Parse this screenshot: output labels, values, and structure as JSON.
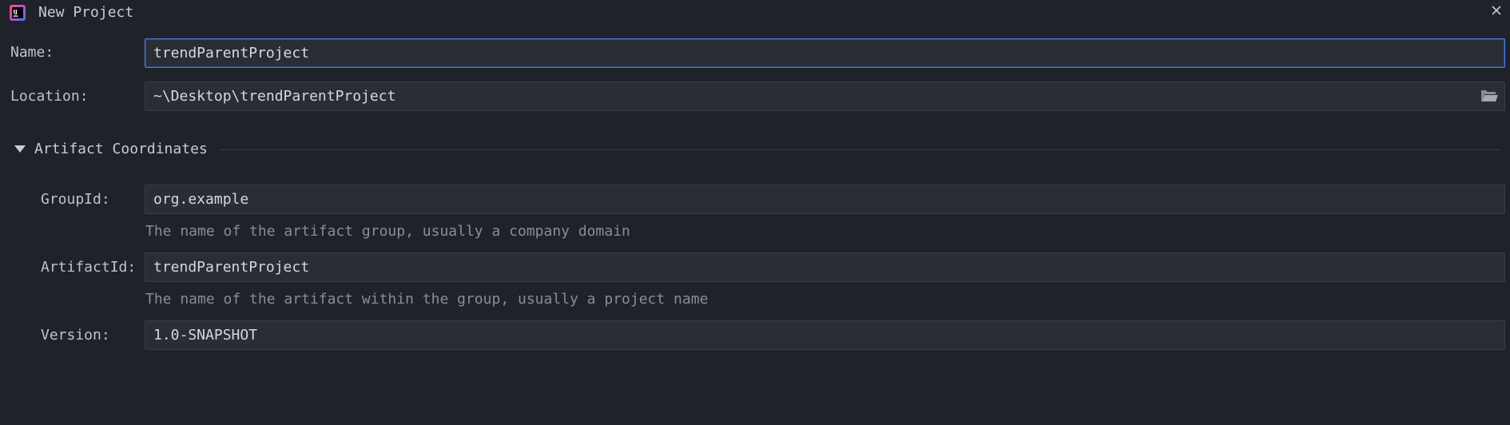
{
  "window": {
    "title": "New Project"
  },
  "form": {
    "name": {
      "label": "Name:",
      "value": "trendParentProject"
    },
    "location": {
      "label": "Location:",
      "value": "~\\Desktop\\trendParentProject"
    },
    "artifact_section": {
      "title": "Artifact Coordinates",
      "expanded": true,
      "group_id": {
        "label": "GroupId:",
        "value": "org.example",
        "hint": "The name of the artifact group, usually a company domain"
      },
      "artifact_id": {
        "label": "ArtifactId:",
        "value": "trendParentProject",
        "hint": "The name of the artifact within the group, usually a project name"
      },
      "version": {
        "label": "Version:",
        "value": "1.0-SNAPSHOT"
      }
    }
  },
  "icons": {
    "app": "intellij-idea-icon",
    "close": "close-icon",
    "browse": "folder-icon",
    "expand": "triangle-down-icon"
  },
  "colors": {
    "background": "#1f2228",
    "field_background": "#2a2d34",
    "focus_border": "#4c7be0",
    "hint_text": "#8a8d94"
  }
}
